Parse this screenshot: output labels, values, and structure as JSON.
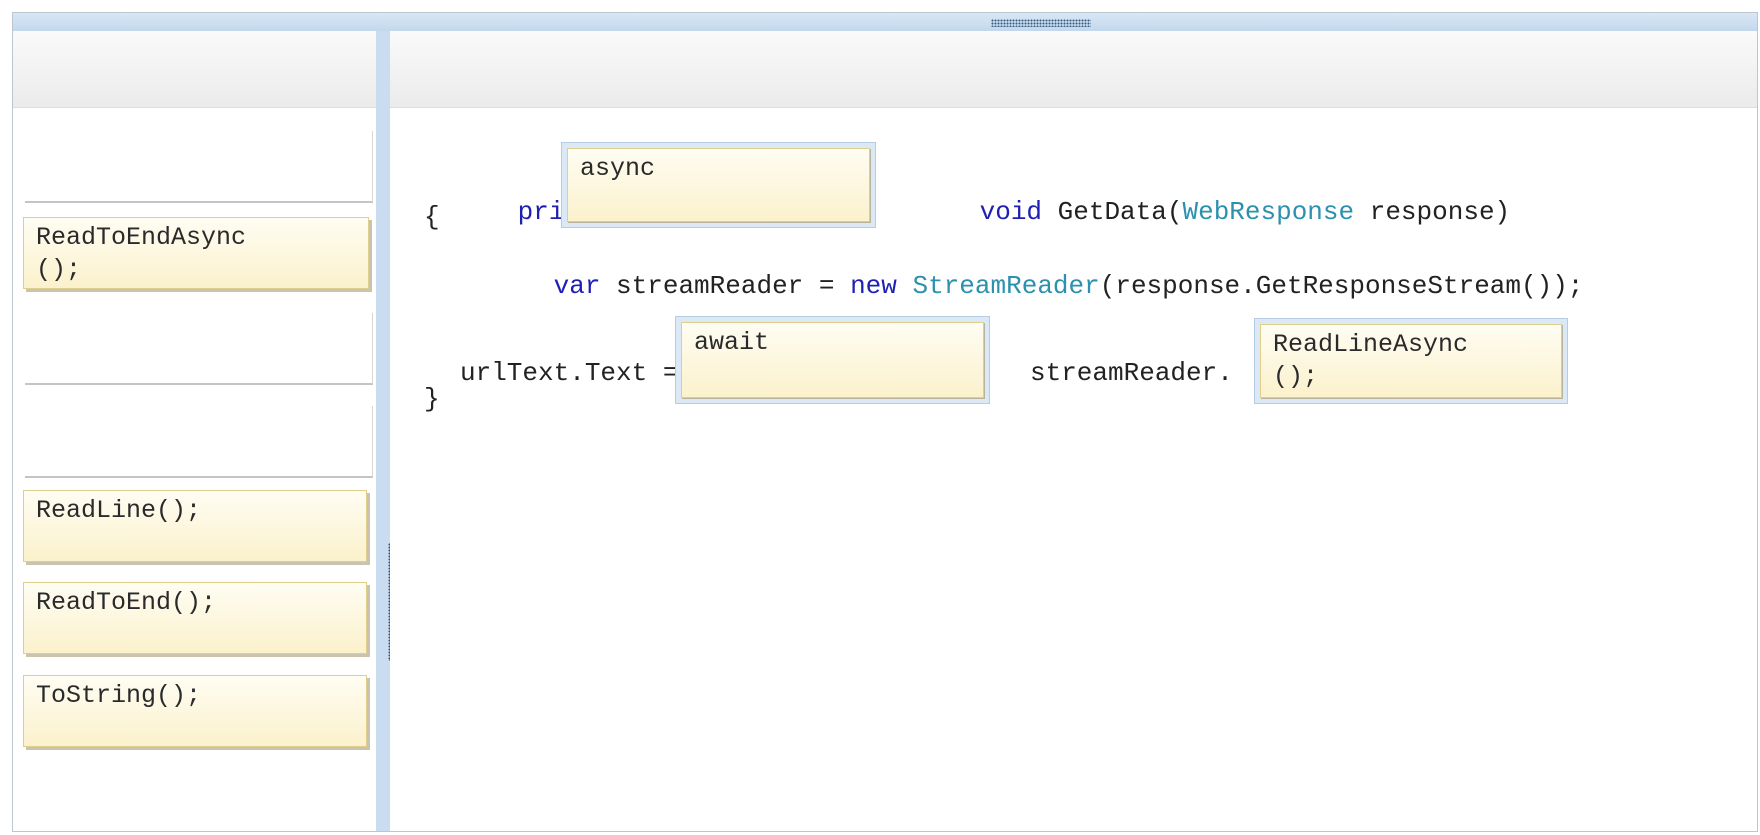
{
  "choices": [
    {
      "label": ""
    },
    {
      "label": "ReadToEndAsync\n();"
    },
    {
      "label": ""
    },
    {
      "label": ""
    },
    {
      "label": "ReadLine();"
    },
    {
      "label": "ReadToEnd();"
    },
    {
      "label": "ToString();"
    }
  ],
  "code": {
    "line1": {
      "private": "private",
      "void": "void",
      "method": " GetData(",
      "type": "WebResponse",
      "rest": " response)"
    },
    "brace_open": "{",
    "line2": {
      "var": "var",
      "mid": " streamReader = ",
      "new": "new",
      "sp": " ",
      "type": "StreamReader",
      "rest": "(response.GetResponseStream());"
    },
    "line3": {
      "lhs": "urlText.Text =",
      "mid": "streamReader."
    },
    "brace_close": "}"
  },
  "targets": {
    "target1": "async",
    "target2": "await",
    "target3": "ReadLineAsync\n();"
  }
}
